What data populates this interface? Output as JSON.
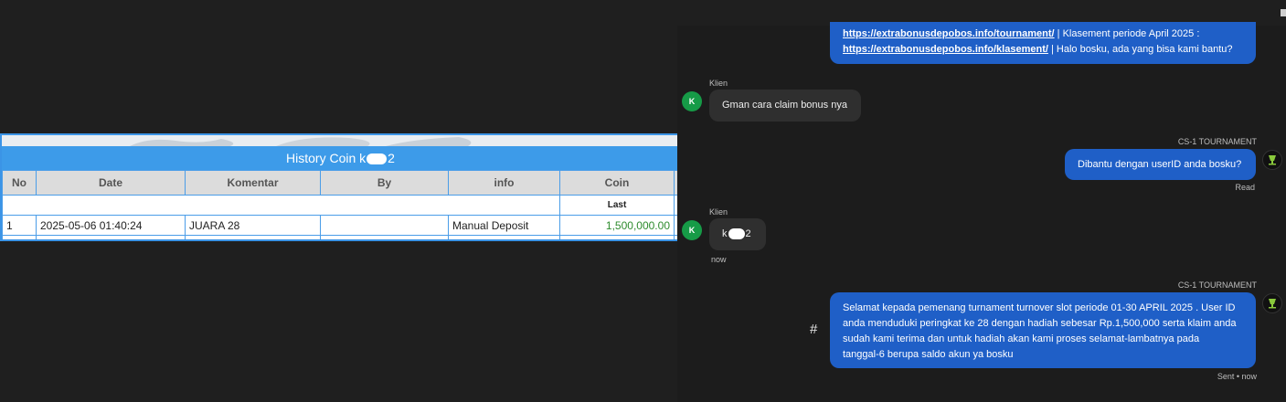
{
  "table": {
    "title_prefix": "History Coin k",
    "title_suffix": "2",
    "headers": [
      "No",
      "Date",
      "Komentar",
      "By",
      "info",
      "Coin"
    ],
    "sub_header": "Last",
    "rows": [
      {
        "no": "1",
        "date": "2025-05-06 01:40:24",
        "komentar": "JUARA 28",
        "by": "",
        "info": "Manual Deposit",
        "coin": "1,500,000.00"
      }
    ]
  },
  "chat": {
    "msg1": {
      "link1": "https://extrabonusdepobos.info/tournament/",
      "text1": " | Klasement periode April 2025 :",
      "link2": "https://extrabonusdepobos.info/klasement/",
      "text2": " | Halo bosku, ada yang bisa kami bantu?"
    },
    "msg2": {
      "sender": "Klien",
      "avatar": "K",
      "text": "Gman cara claim bonus nya"
    },
    "msg3": {
      "sender": "CS-1 TOURNAMENT",
      "text": "Dibantu dengan userID anda bosku?",
      "status": "Read"
    },
    "msg4": {
      "sender": "Klien",
      "avatar": "K",
      "text_prefix": "k",
      "text_suffix": "2",
      "time": "now"
    },
    "msg5": {
      "sender": "CS-1 TOURNAMENT",
      "lines": [
        "Selamat kepada pemenang turnament turnover slot periode 01-30 APRIL 2025 . User ID",
        "anda menduduki peringkat ke 28 dengan hadiah sebesar Rp.1,500,000 serta klaim anda",
        "sudah kami terima dan untuk hadiah akan kami proses selamat-lambatnya pada",
        "tanggal-6 berupa saldo akun ya bosku"
      ],
      "status": "Sent • now"
    },
    "hash_symbol": "#"
  },
  "colors": {
    "header_blue": "#3d9be9",
    "bubble_blue": "#1f5fc7",
    "avatar_green": "#169b47",
    "coin_green": "#2e8b2e"
  }
}
